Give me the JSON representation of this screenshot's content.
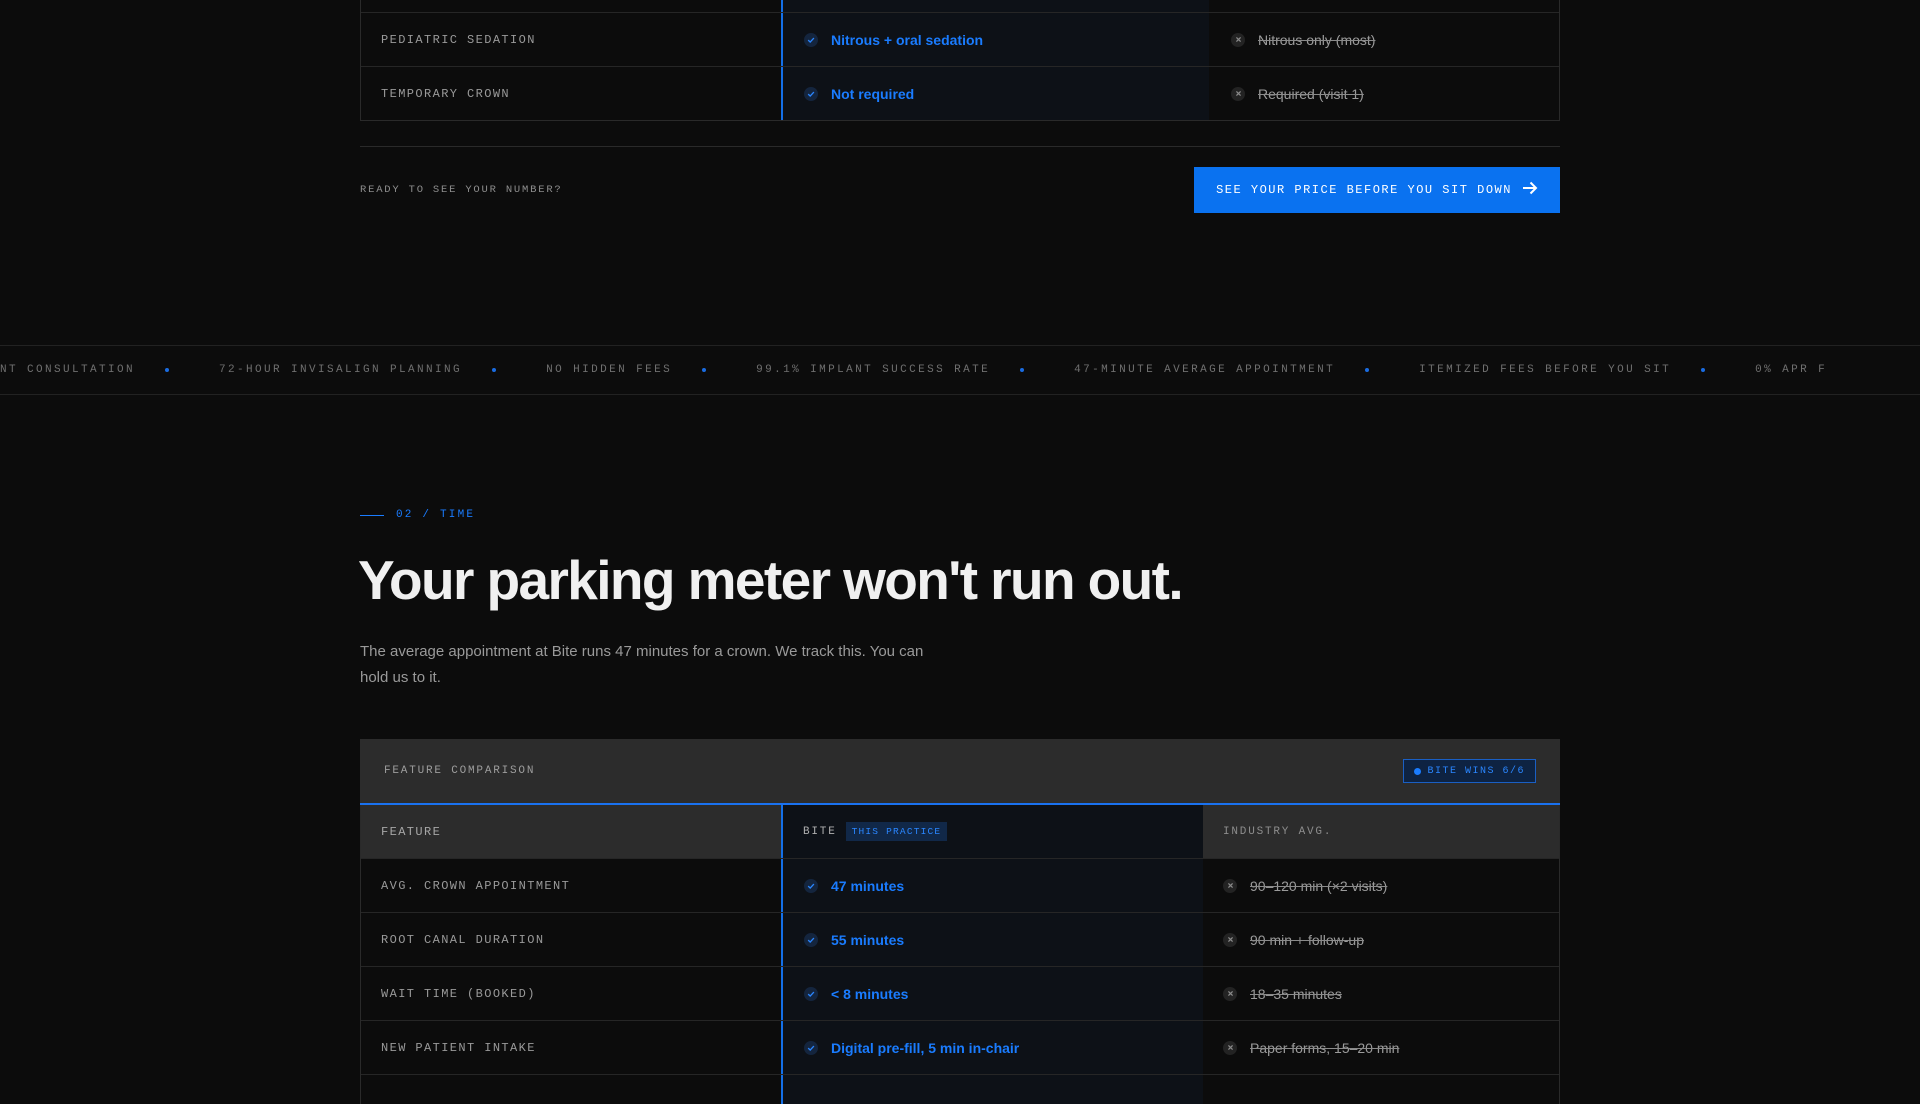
{
  "top_table": {
    "rows": [
      {
        "feature": "PEDIATRIC SEDATION",
        "bite": "Nitrous + oral sedation",
        "industry": "Nitrous only (most)"
      },
      {
        "feature": "TEMPORARY CROWN",
        "bite": "Not required",
        "industry": "Required (visit 1)"
      }
    ]
  },
  "cta": {
    "prompt": "READY TO SEE YOUR NUMBER?",
    "button_label": "SEE YOUR PRICE BEFORE YOU SIT DOWN"
  },
  "ticker": {
    "items": [
      "PLANT CONSULTATION",
      "72-HOUR INVISALIGN PLANNING",
      "NO HIDDEN FEES",
      "99.1% IMPLANT SUCCESS RATE",
      "47-MINUTE AVERAGE APPOINTMENT",
      "ITEMIZED FEES BEFORE YOU SIT",
      "0% APR F"
    ]
  },
  "section": {
    "eyebrow": "02 / TIME",
    "headline": "Your parking meter won't run out.",
    "paragraph": "The average appointment at Bite runs 47 minutes for a crown. We track this. You can hold us to it."
  },
  "comparison": {
    "title": "FEATURE COMPARISON",
    "badge": "BITE WINS 6/6",
    "col_feature": "FEATURE",
    "col_bite": "BITE",
    "col_bite_pill": "THIS PRACTICE",
    "col_industry": "INDUSTRY AVG.",
    "rows": [
      {
        "feature": "AVG. CROWN APPOINTMENT",
        "bite": "47 minutes",
        "industry": "90–120 min (×2 visits)"
      },
      {
        "feature": "ROOT CANAL DURATION",
        "bite": "55 minutes",
        "industry": "90 min + follow-up"
      },
      {
        "feature": "WAIT TIME (BOOKED)",
        "bite": "< 8 minutes",
        "industry": "18–35 minutes"
      },
      {
        "feature": "NEW PATIENT INTAKE",
        "bite": "Digital pre-fill, 5 min in-chair",
        "industry": "Paper forms, 15–20 min"
      }
    ]
  },
  "colors": {
    "accent": "#0a72f0",
    "background": "#0c0c0c"
  },
  "icons": {
    "bite_cell": "check-icon",
    "industry_cell": "x-icon",
    "button": "arrow-right-icon"
  }
}
